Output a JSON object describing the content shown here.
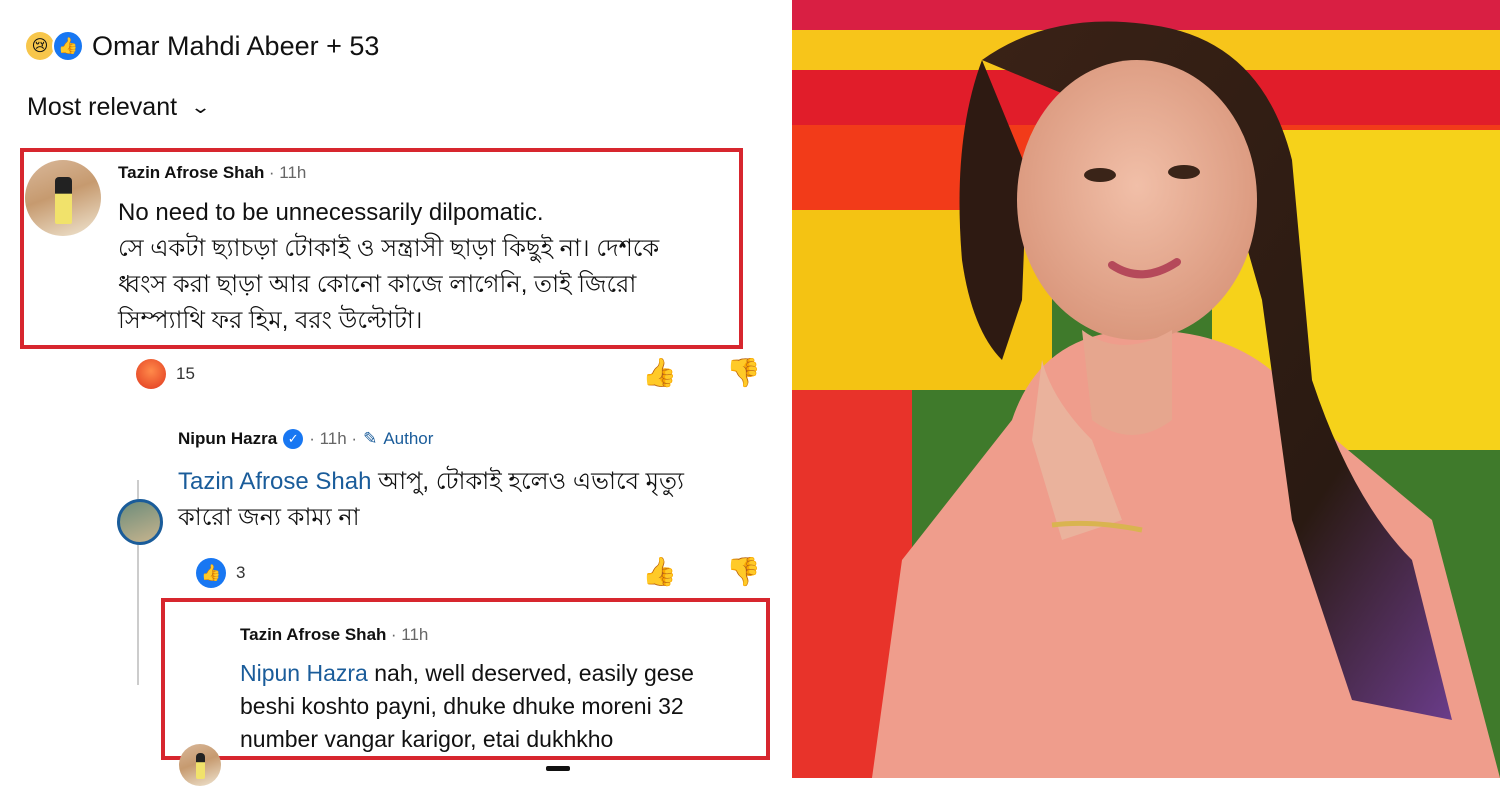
{
  "reactions_header": {
    "label": "Omar Mahdi Abeer + 53",
    "icons": [
      "crying-face-icon",
      "thumbs-up-icon"
    ]
  },
  "sort": {
    "label": "Most relevant",
    "icon": "chevron-down-icon"
  },
  "comment1": {
    "author": "Tazin Afrose Shah",
    "time": "· 11h",
    "lines": [
      "No need to be unnecessarily dilpomatic.",
      "সে একটা ছ্যাচড়া টোকাই ও সন্ত্রাসী ছাড়া কিছুই না। দেশকে",
      "ধ্বংস করা ছাড়া আর কোনো কাজে লাগেনি, তাই জিরো",
      "সিম্প্যাথি ফর হিম, বরং উল্টোটা।"
    ],
    "reaction_count": "15",
    "reaction_icon": "angry-face-icon"
  },
  "reply1": {
    "author": "Nipun Hazra",
    "time": "· 11h ·",
    "badge": "Author",
    "mention": "Tazin Afrose Shah",
    "line1": "আপু, টোকাই হলেও এভাবে মৃত্যু",
    "line2": "কারো জন্য কাম্য না",
    "reaction_count": "3",
    "reaction_icon": "thumbs-up-icon"
  },
  "reply2": {
    "author": "Tazin Afrose Shah",
    "time": "· 11h",
    "mention": "Nipun Hazra",
    "line1": "nah, well deserved, easily gese",
    "line2": "beshi koshto payni, dhuke dhuke moreni 32",
    "line3": "number vangar karigor, etai dukhkho"
  },
  "colors": {
    "highlight_border": "#d7262e",
    "mention": "#1a5c9a",
    "like_blue": "#1877f2"
  }
}
